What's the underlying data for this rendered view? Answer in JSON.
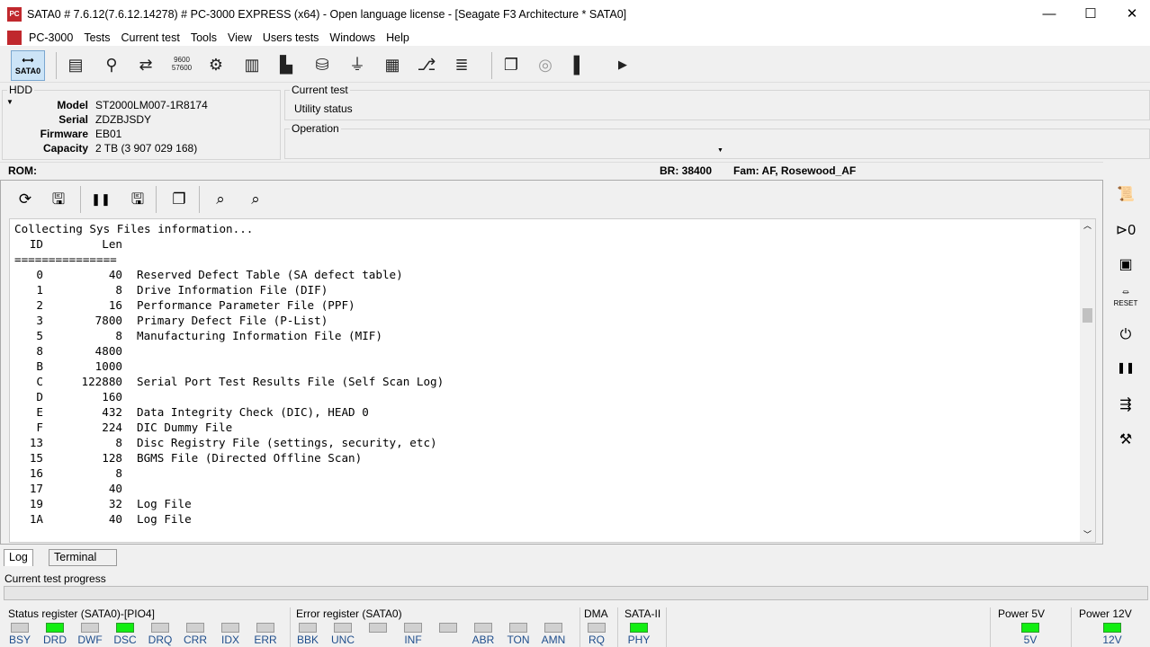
{
  "window": {
    "title": "SATA0 # 7.6.12(7.6.12.14278) # PC-3000 EXPRESS (x64) - Open language license - [Seagate F3 Architecture * SATA0]",
    "app_icon": "PC"
  },
  "menu": [
    "PC-3000",
    "Tests",
    "Current test",
    "Tools",
    "View",
    "Users tests",
    "Windows",
    "Help"
  ],
  "toolbar": {
    "sata_label": "SATA0"
  },
  "hdd": {
    "group_label": "HDD",
    "fields": [
      {
        "k": "Model",
        "v": "ST2000LM007-1R8174"
      },
      {
        "k": "Serial",
        "v": "ZDZBJSDY"
      },
      {
        "k": "Firmware",
        "v": "EB01"
      },
      {
        "k": "Capacity",
        "v": "2 TB (3 907 029 168)"
      }
    ]
  },
  "current_test": {
    "label": "Current test",
    "value": "Utility status"
  },
  "operation": {
    "label": "Operation"
  },
  "rom": {
    "label": "ROM:",
    "br": "BR: 38400",
    "fam": "Fam: AF, Rosewood_AF"
  },
  "log": {
    "heading": "Collecting Sys Files information...",
    "col_id": "ID",
    "col_len": "Len",
    "divider": "===============",
    "rows": [
      {
        "id": "0",
        "len": "40",
        "desc": "Reserved Defect Table (SA defect table)"
      },
      {
        "id": "1",
        "len": "8",
        "desc": "Drive Information File (DIF)"
      },
      {
        "id": "2",
        "len": "16",
        "desc": "Performance Parameter File (PPF)"
      },
      {
        "id": "3",
        "len": "7800",
        "desc": "Primary Defect File (P-List)"
      },
      {
        "id": "5",
        "len": "8",
        "desc": "Manufacturing Information File (MIF)"
      },
      {
        "id": "8",
        "len": "4800",
        "desc": ""
      },
      {
        "id": "B",
        "len": "1000",
        "desc": ""
      },
      {
        "id": "C",
        "len": "122880",
        "desc": "Serial Port Test Results File (Self Scan Log)"
      },
      {
        "id": "D",
        "len": "160",
        "desc": ""
      },
      {
        "id": "E",
        "len": "432",
        "desc": "Data Integrity Check (DIC), HEAD 0"
      },
      {
        "id": "F",
        "len": "224",
        "desc": "DIC Dummy File"
      },
      {
        "id": "13",
        "len": "8",
        "desc": "Disc Registry File (settings, security, etc)"
      },
      {
        "id": "15",
        "len": "128",
        "desc": "BGMS File (Directed Offline Scan)"
      },
      {
        "id": "16",
        "len": "8",
        "desc": ""
      },
      {
        "id": "17",
        "len": "40",
        "desc": ""
      },
      {
        "id": "19",
        "len": "32",
        "desc": "Log File"
      },
      {
        "id": "1A",
        "len": "40",
        "desc": "Log File"
      }
    ]
  },
  "tabs": [
    "Log",
    "Terminal"
  ],
  "progress": {
    "label": "Current test progress",
    "value": 0
  },
  "status_register": {
    "label": "Status register (SATA0)-[PIO4]",
    "bits": [
      {
        "n": "BSY",
        "on": false
      },
      {
        "n": "DRD",
        "on": true
      },
      {
        "n": "DWF",
        "on": false
      },
      {
        "n": "DSC",
        "on": true
      },
      {
        "n": "DRQ",
        "on": false
      },
      {
        "n": "CRR",
        "on": false
      },
      {
        "n": "IDX",
        "on": false
      },
      {
        "n": "ERR",
        "on": false
      }
    ]
  },
  "error_register": {
    "label": "Error register (SATA0)",
    "bits": [
      {
        "n": "BBK",
        "on": false
      },
      {
        "n": "UNC",
        "on": false
      },
      {
        "n": "",
        "on": false
      },
      {
        "n": "INF",
        "on": false
      },
      {
        "n": "",
        "on": false
      },
      {
        "n": "ABR",
        "on": false
      },
      {
        "n": "TON",
        "on": false
      },
      {
        "n": "AMN",
        "on": false
      }
    ]
  },
  "dma": {
    "label": "DMA",
    "bits": [
      {
        "n": "RQ",
        "on": false
      }
    ]
  },
  "sata": {
    "label": "SATA-II",
    "bits": [
      {
        "n": "PHY",
        "on": true
      }
    ]
  },
  "power5": {
    "label": "Power 5V",
    "bits": [
      {
        "n": "5V",
        "on": true
      }
    ]
  },
  "power12": {
    "label": "Power 12V",
    "bits": [
      {
        "n": "12V",
        "on": true
      }
    ]
  },
  "colors": {
    "led_on": "#12ee12",
    "led_off": "#d0d0d0"
  }
}
